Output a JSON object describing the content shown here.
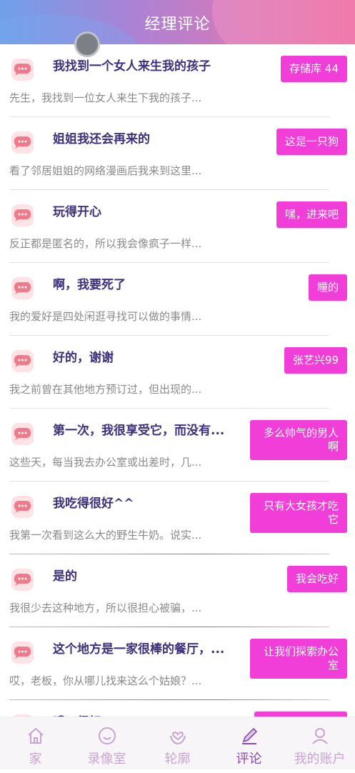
{
  "header": {
    "title": "经理评论"
  },
  "items": [
    {
      "title": "我找到一个女人来生我的孩子",
      "preview": "先生，我找到一位女人来生下我的孩子...",
      "tag": "存储库 44"
    },
    {
      "title": "姐姐我还会再来的",
      "preview": "看了邻居姐姐的网络漫画后我来到这里...",
      "tag": "这是一只狗"
    },
    {
      "title": "玩得开心",
      "preview": "反正都是匿名的，所以我会像疯子一样...",
      "tag": "嘿，进来吧"
    },
    {
      "title": "啊，我要死了",
      "preview": "我的爱好是四处闲逛寻找可以做的事情...",
      "tag": "瞳的"
    },
    {
      "title": "好的，谢谢",
      "preview": "我之前曾在其他地方预订过，但出现的...",
      "tag": "张艺兴99"
    },
    {
      "title": "第一次，我很享受它，而没有...",
      "preview": "这些天，每当我去办公室或出差时，几...",
      "tag": "多么帅气的男人啊"
    },
    {
      "title": "我吃得很好^^",
      "preview": "我第一次看到这么大的野生牛奶。说实...",
      "tag": "只有大女孩才吃它"
    },
    {
      "title": "是的",
      "preview": "我很少去这种地方，所以很担心被骗，...",
      "tag": "我会吃好"
    },
    {
      "title": "这个地方是一家很棒的餐厅，...",
      "preview": "哎，老板，你从哪儿找来这么个姑娘？...",
      "tag": "让我们探索办公室"
    },
    {
      "title": "哦，很好",
      "preview": "",
      "tag": ""
    }
  ],
  "nav": [
    {
      "label": "家",
      "icon": "home-icon"
    },
    {
      "label": "录像室",
      "icon": "smile-icon"
    },
    {
      "label": "轮廓",
      "icon": "heart-hands-icon"
    },
    {
      "label": "评论",
      "icon": "pencil-icon"
    },
    {
      "label": "我的账户",
      "icon": "user-icon"
    }
  ],
  "colors": {
    "accent": "#f23ed8",
    "title": "#3f2f7a",
    "nav_active": "#8a4ca8",
    "nav_inactive": "#c9a3d2"
  }
}
